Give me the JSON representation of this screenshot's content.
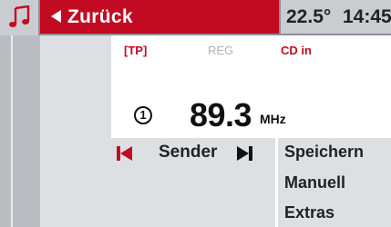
{
  "header": {
    "music_icon": "music-note-icon",
    "back_label": "Zurück",
    "temperature": "22.5°",
    "time": "14:45"
  },
  "status_flags": {
    "tp": "[TP]",
    "reg": "REG",
    "cd": "CD in"
  },
  "tuner": {
    "preset_number": "1",
    "frequency": "89.3",
    "unit": "MHz"
  },
  "controls": {
    "seek_label": "Sender"
  },
  "menu": {
    "items": [
      "Speichern",
      "Manuell",
      "Extras"
    ]
  },
  "colors": {
    "accent": "#c20b22",
    "panel": "#dde0e3",
    "sidebar": "#b9bdc2"
  }
}
